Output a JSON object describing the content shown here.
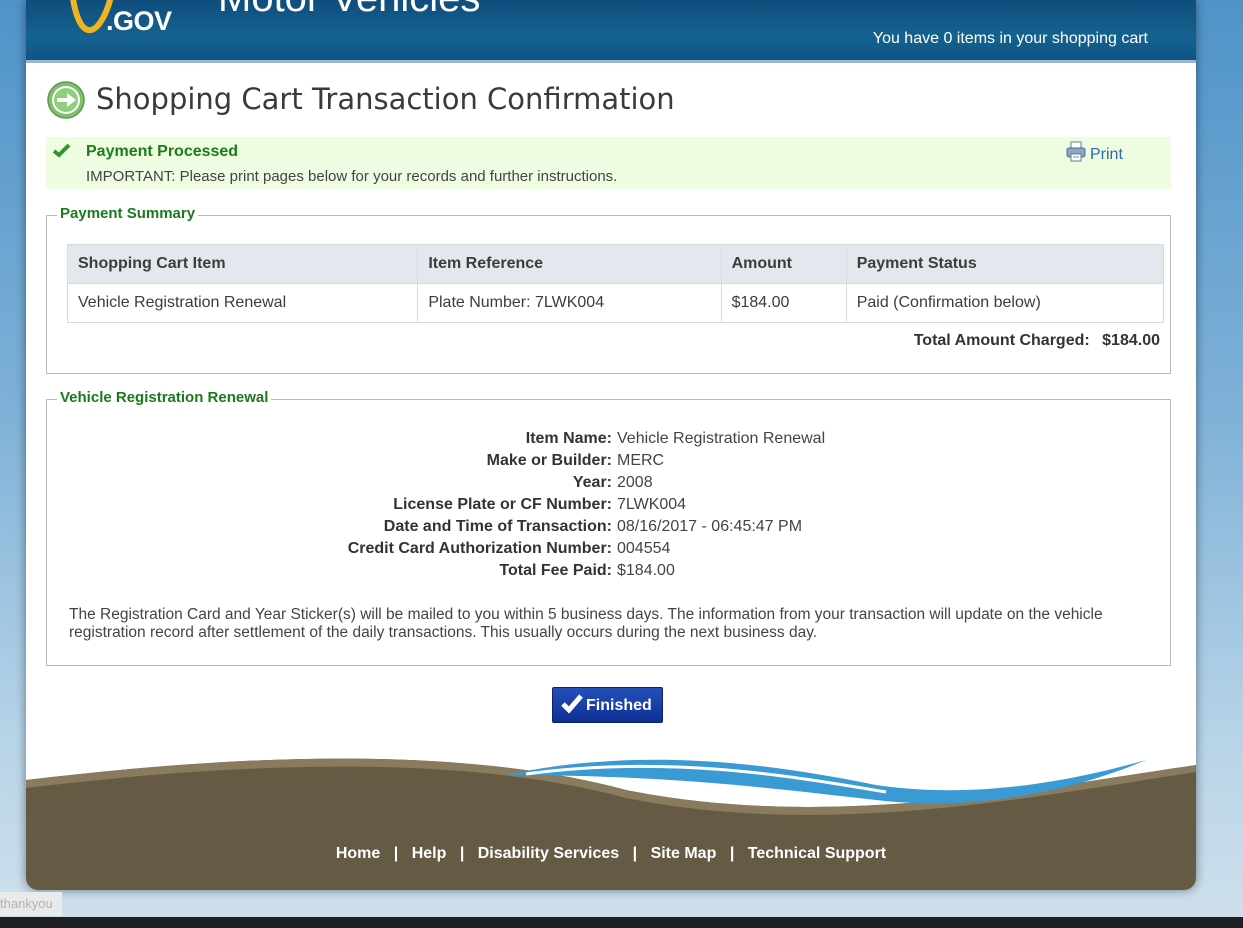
{
  "header": {
    "logo_text": ".GOV",
    "agency_text": "Motor Vehicles",
    "cart_status": "You have 0 items in your shopping cart"
  },
  "page_title": "Shopping Cart Transaction Confirmation",
  "alert": {
    "title": "Payment Processed",
    "message": "IMPORTANT: Please print pages below for your records and further instructions.",
    "print_label": "Print"
  },
  "payment_summary": {
    "legend": "Payment Summary",
    "columns": [
      "Shopping Cart Item",
      "Item Reference",
      "Amount",
      "Payment Status"
    ],
    "rows": [
      [
        "Vehicle Registration Renewal",
        "Plate Number: 7LWK004",
        "$184.00",
        "Paid (Confirmation below)"
      ]
    ],
    "total_label": "Total Amount Charged:",
    "total_value": "$184.00"
  },
  "renewal": {
    "legend": "Vehicle Registration Renewal",
    "details": [
      {
        "label": "Item Name:",
        "value": "Vehicle Registration Renewal"
      },
      {
        "label": "Make or Builder:",
        "value": "MERC"
      },
      {
        "label": "Year:",
        "value": "2008"
      },
      {
        "label": "License Plate or CF Number:",
        "value": "7LWK004"
      },
      {
        "label": "Date and Time of Transaction:",
        "value": "08/16/2017 - 06:45:47 PM"
      },
      {
        "label": "Credit Card Authorization Number:",
        "value": "004554"
      },
      {
        "label": "Total Fee Paid:",
        "value": "$184.00"
      }
    ],
    "note": "The Registration Card and Year Sticker(s) will be mailed to you within 5 business days. The information from your transaction will update on the vehicle registration record after settlement of the daily transactions. This usually occurs during the next business day."
  },
  "finished_label": "Finished",
  "footer": {
    "links": [
      "Home",
      "Help",
      "Disability Services",
      "Site Map",
      "Technical Support"
    ],
    "separator": "|"
  },
  "status_text": "thankyou",
  "colors": {
    "header_blue": "#15628f",
    "alert_bg": "#eefce2",
    "legend_green": "#1b7a1b",
    "button_blue": "#1a42a8",
    "footer_brown": "#655a44"
  }
}
